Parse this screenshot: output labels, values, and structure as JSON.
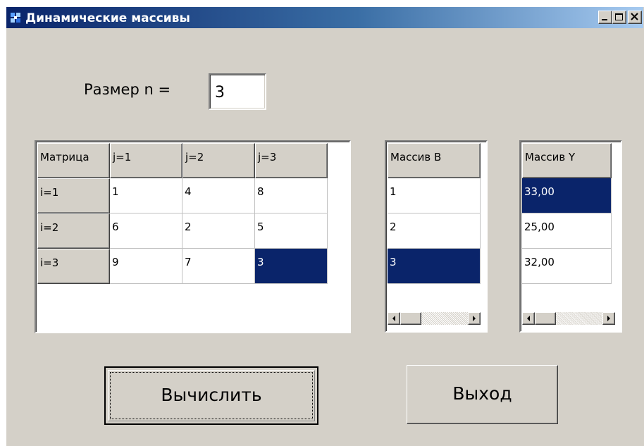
{
  "window": {
    "title": "Динамические массивы",
    "minimize_glyph": "_",
    "maximize_glyph": "□",
    "close_glyph": "×"
  },
  "size": {
    "label": "Размер n =",
    "value": "3"
  },
  "matrix": {
    "corner": "Матрица",
    "col_headers": [
      "j=1",
      "j=2",
      "j=3"
    ],
    "row_headers": [
      "i=1",
      "i=2",
      "i=3"
    ],
    "rows": [
      [
        "1",
        "4",
        "8"
      ],
      [
        "6",
        "2",
        "5"
      ],
      [
        "9",
        "7",
        "3"
      ]
    ],
    "selected_cell": "row 3, column 3"
  },
  "array_b": {
    "header": "Массив B",
    "values": [
      "1",
      "2",
      "3"
    ],
    "selected_row": 3
  },
  "array_y": {
    "header": "Массив Y",
    "values": [
      "33,00",
      "25,00",
      "32,00"
    ],
    "selected_row": 1
  },
  "buttons": {
    "calculate": "Вычислить",
    "exit": "Выход"
  },
  "colors": {
    "face": "#d4d0c8",
    "selection": "#0a246a",
    "title_start": "#0a246a",
    "title_end": "#a6caf0"
  }
}
